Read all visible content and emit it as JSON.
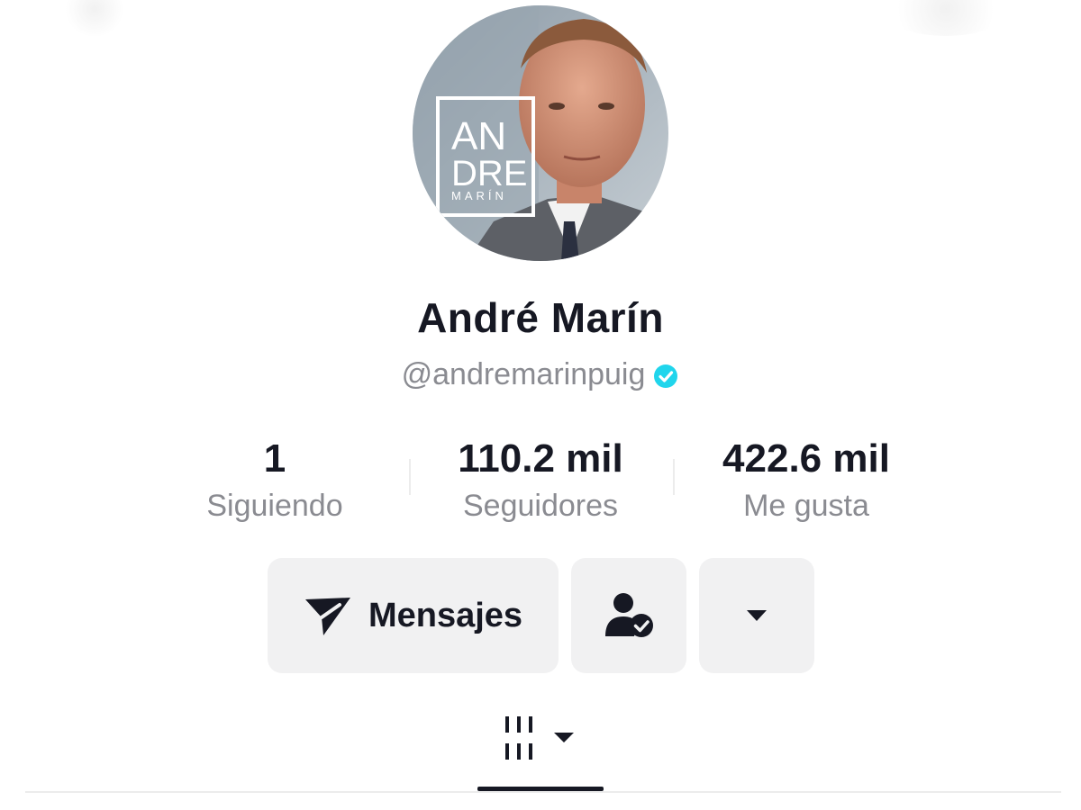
{
  "profile": {
    "display_name": "André Marín",
    "handle": "@andremarinpuig",
    "verified": true,
    "avatar_logo": [
      "AN",
      "DRE",
      "MARÍN"
    ]
  },
  "stats": [
    {
      "value": "1",
      "label": "Siguiendo"
    },
    {
      "value": "110.2 mil",
      "label": "Seguidores"
    },
    {
      "value": "422.6 mil",
      "label": "Me gusta"
    }
  ],
  "actions": {
    "messages_label": "Mensajes",
    "messages_icon": "send-icon",
    "follow_status_icon": "user-check-icon",
    "more_icon": "caret-down-icon"
  },
  "tabs": {
    "videos_icon": "grid-columns-icon"
  },
  "colors": {
    "text_primary": "#161823",
    "text_secondary": "#8a8b91",
    "button_bg": "#f1f1f2",
    "verified": "#20d5ec"
  }
}
